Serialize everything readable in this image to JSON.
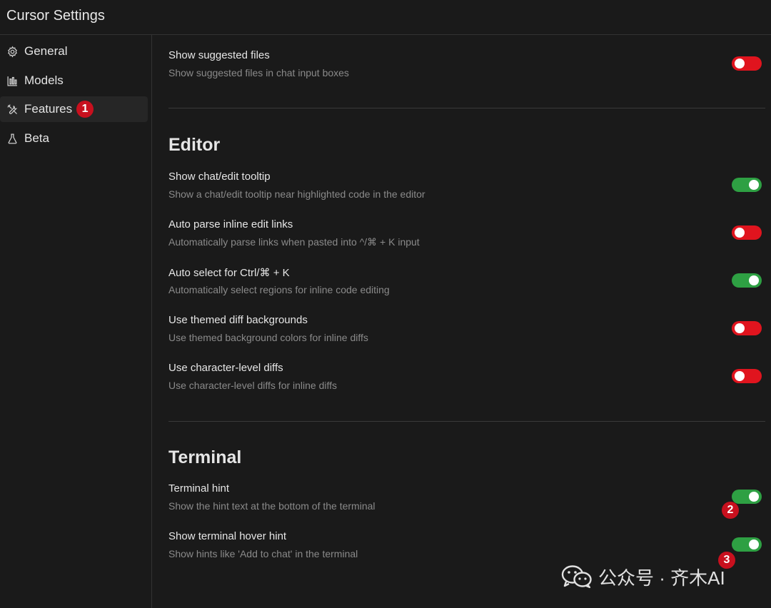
{
  "window": {
    "title": "Cursor Settings"
  },
  "sidebar": {
    "items": [
      {
        "label": "General",
        "icon": "gear-icon"
      },
      {
        "label": "Models",
        "icon": "bar-chart-icon"
      },
      {
        "label": "Features",
        "icon": "tools-icon",
        "active": true,
        "badge": "1"
      },
      {
        "label": "Beta",
        "icon": "flask-icon"
      }
    ]
  },
  "top_setting": {
    "title": "Show suggested files",
    "description": "Show suggested files in chat input boxes",
    "enabled": false
  },
  "editor": {
    "heading": "Editor",
    "settings": [
      {
        "title": "Show chat/edit tooltip",
        "description": "Show a chat/edit tooltip near highlighted code in the editor",
        "enabled": true
      },
      {
        "title": "Auto parse inline edit links",
        "description": "Automatically parse links when pasted into ^/⌘ + K input",
        "enabled": false
      },
      {
        "title": "Auto select for Ctrl/⌘ + K",
        "description": "Automatically select regions for inline code editing",
        "enabled": true
      },
      {
        "title": "Use themed diff backgrounds",
        "description": "Use themed background colors for inline diffs",
        "enabled": false
      },
      {
        "title": "Use character-level diffs",
        "description": "Use character-level diffs for inline diffs",
        "enabled": false
      }
    ]
  },
  "terminal": {
    "heading": "Terminal",
    "settings": [
      {
        "title": "Terminal hint",
        "description": "Show the hint text at the bottom of the terminal",
        "enabled": true,
        "badge": "2"
      },
      {
        "title": "Show terminal hover hint",
        "description": "Show hints like 'Add to chat' in the terminal",
        "enabled": true,
        "badge": "3"
      }
    ]
  },
  "watermark": {
    "text": "公众号 · 齐木AI",
    "icon": "wechat-icon"
  },
  "colors": {
    "background": "#1a1a1a",
    "toggle_on": "#2ea043",
    "toggle_off": "#e0141e",
    "badge": "#c8101e"
  }
}
